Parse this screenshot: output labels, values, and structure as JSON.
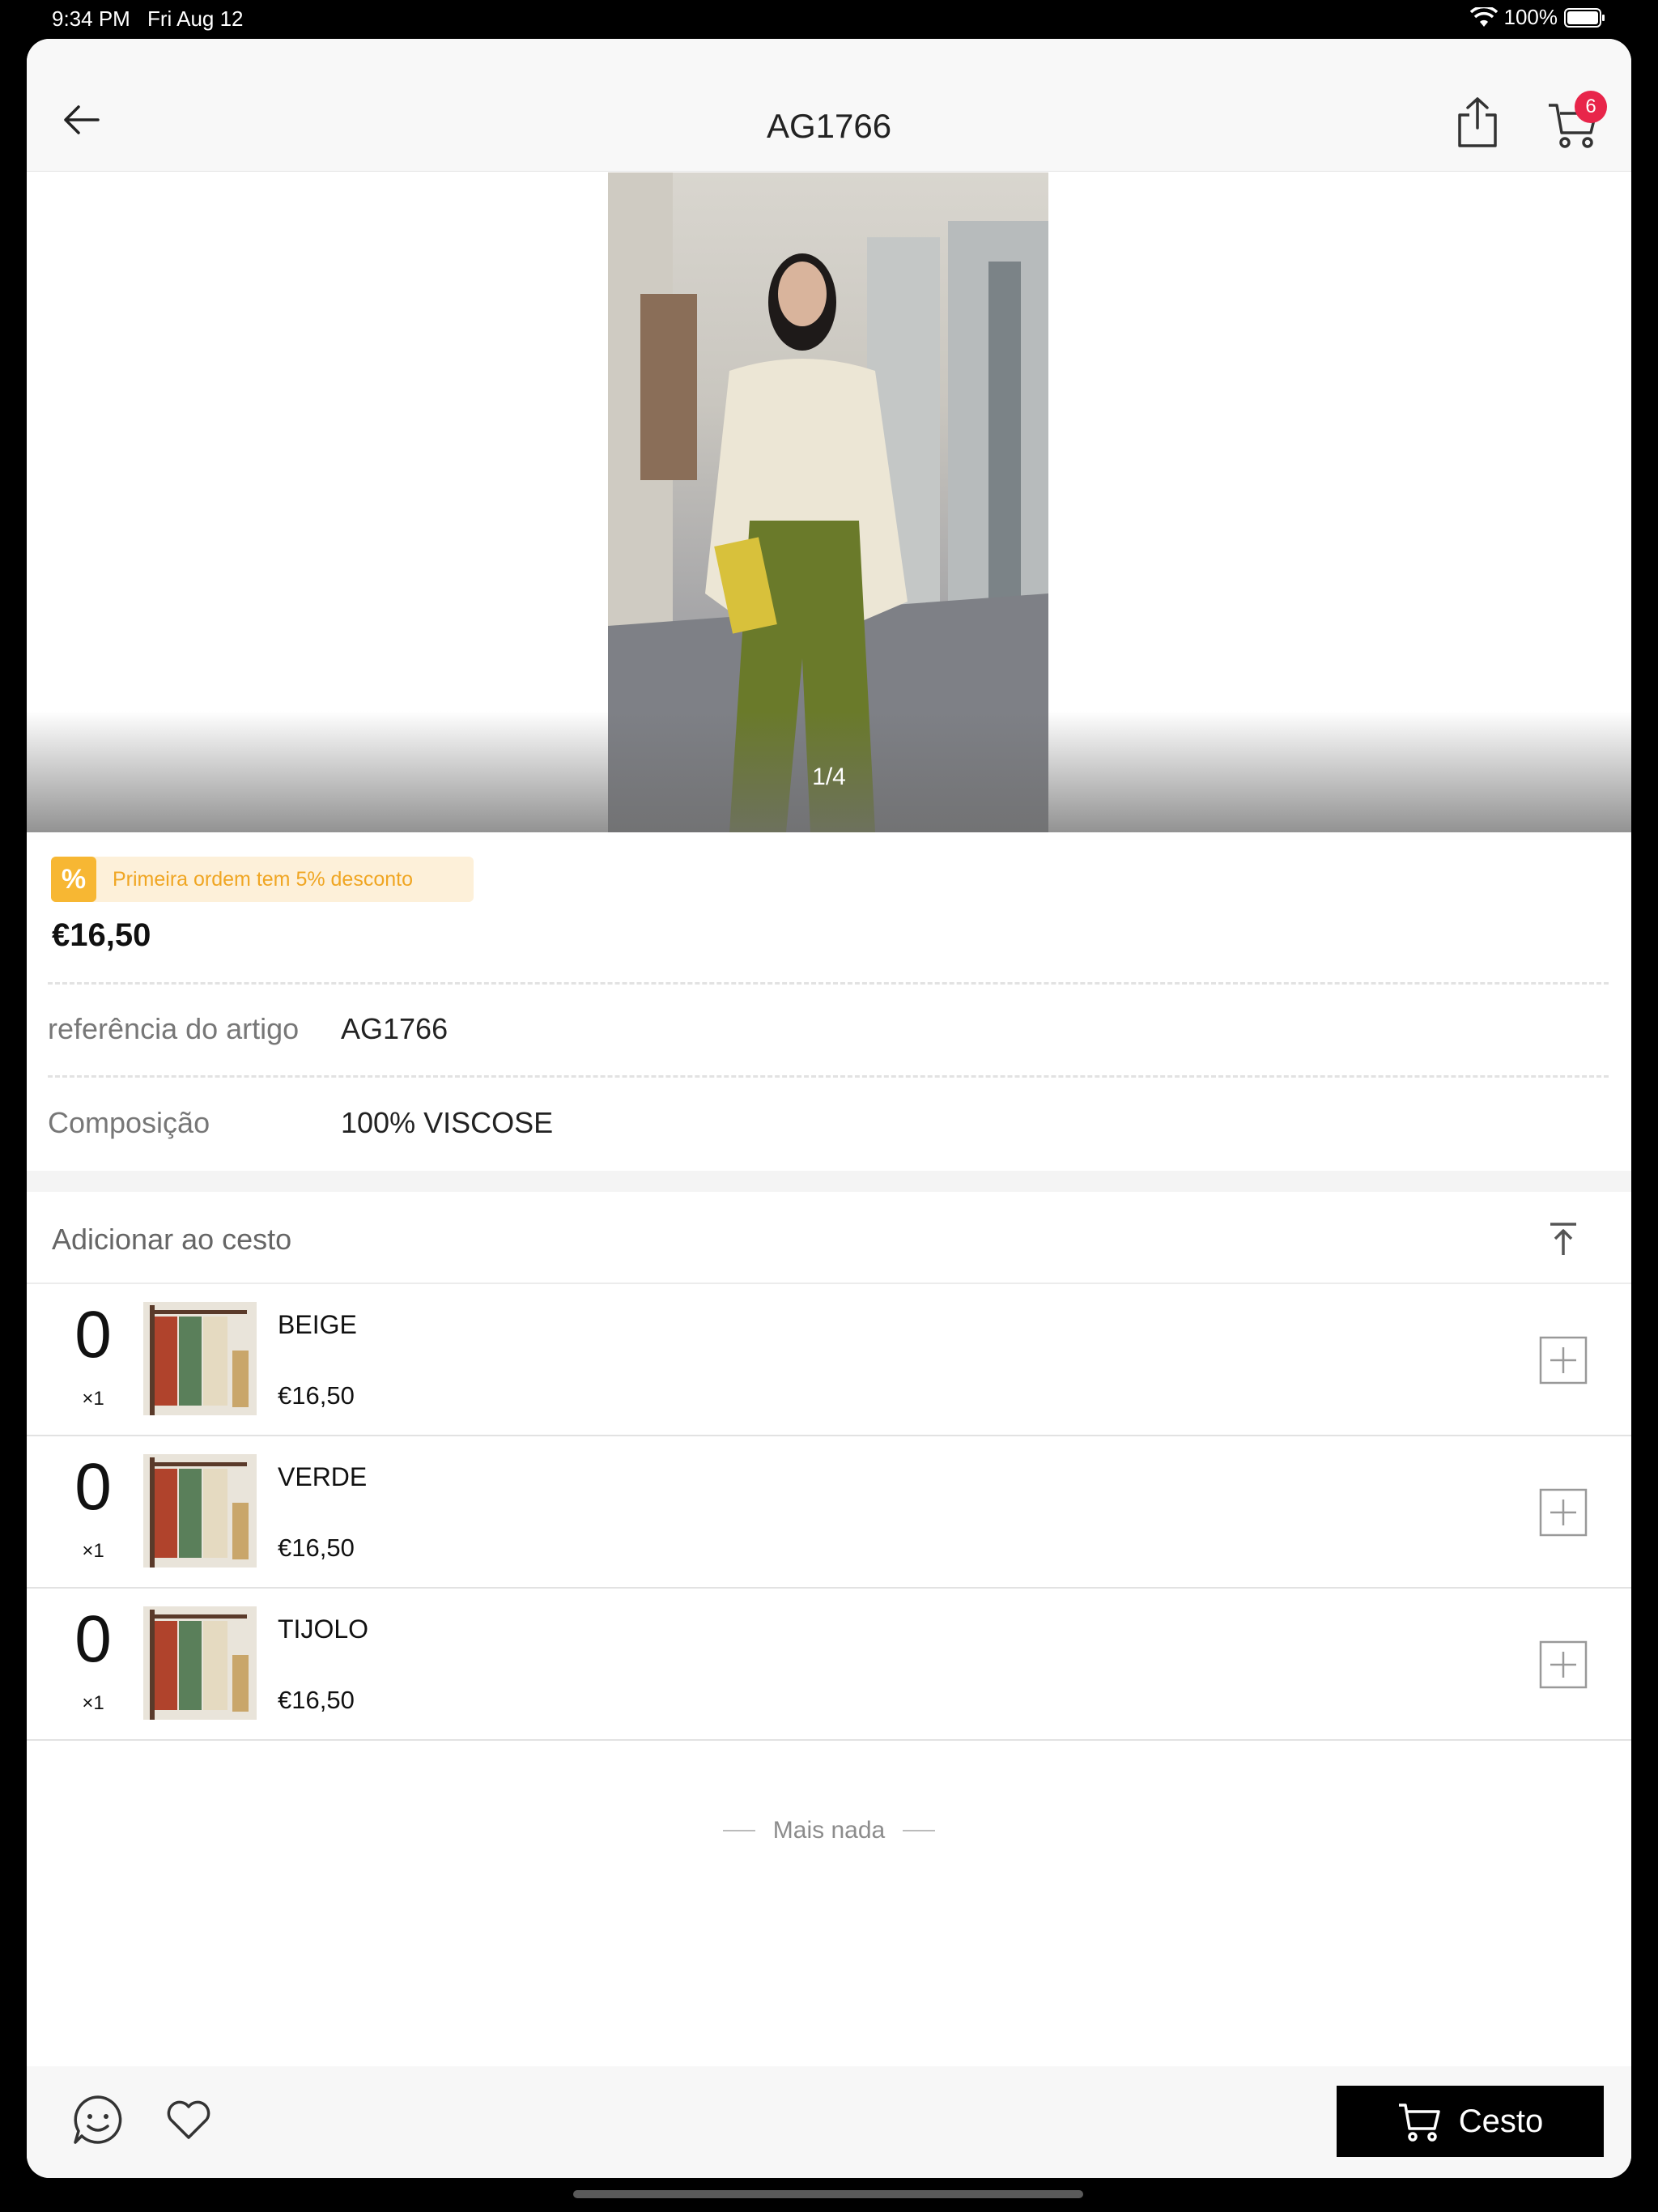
{
  "status": {
    "time": "9:34 PM",
    "date": "Fri Aug 12",
    "battery": "100%"
  },
  "nav": {
    "title": "AG1766",
    "cart_count": "6"
  },
  "hero": {
    "counter": "1/4"
  },
  "promo": {
    "icon": "%",
    "text": "Primeira ordem tem 5% desconto"
  },
  "price": "€16,50",
  "info": [
    {
      "label": "referência do artigo",
      "value": "AG1766"
    },
    {
      "label": "Composição",
      "value": "100% VISCOSE"
    }
  ],
  "add_section": {
    "title": "Adicionar ao cesto"
  },
  "variants": [
    {
      "qty": "0",
      "mult": "×1",
      "name": "BEIGE",
      "price": "€16,50"
    },
    {
      "qty": "0",
      "mult": "×1",
      "name": "VERDE",
      "price": "€16,50"
    },
    {
      "qty": "0",
      "mult": "×1",
      "name": "TIJOLO",
      "price": "€16,50"
    }
  ],
  "end_text": "Mais nada",
  "bottom": {
    "cart_label": "Cesto"
  },
  "colors": {
    "accent_badge": "#e8254a",
    "promo_bg": "#fdf0d9",
    "promo_text": "#f0a623",
    "cta_bg": "#000000"
  },
  "icons": [
    "wifi-icon",
    "battery-icon",
    "back-arrow-icon",
    "share-icon",
    "cart-icon",
    "percent-icon",
    "scroll-top-icon",
    "plus-icon",
    "chat-icon",
    "heart-icon"
  ]
}
